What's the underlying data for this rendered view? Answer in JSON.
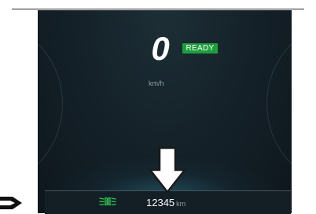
{
  "speedometer": {
    "speed": "0",
    "unit": "km/h",
    "status_badge": "READY"
  },
  "odometer": {
    "value": "12345",
    "unit": "km"
  },
  "icons": {
    "headlight": "low-beam-headlight-icon",
    "arrow": "down-arrow-icon",
    "logo": "partial-logo-icon"
  },
  "colors": {
    "background": "#15222a",
    "ready": "#1e9e3c",
    "headlight": "#2ecc55",
    "text": "#ffffff",
    "muted": "#8f9da3"
  }
}
